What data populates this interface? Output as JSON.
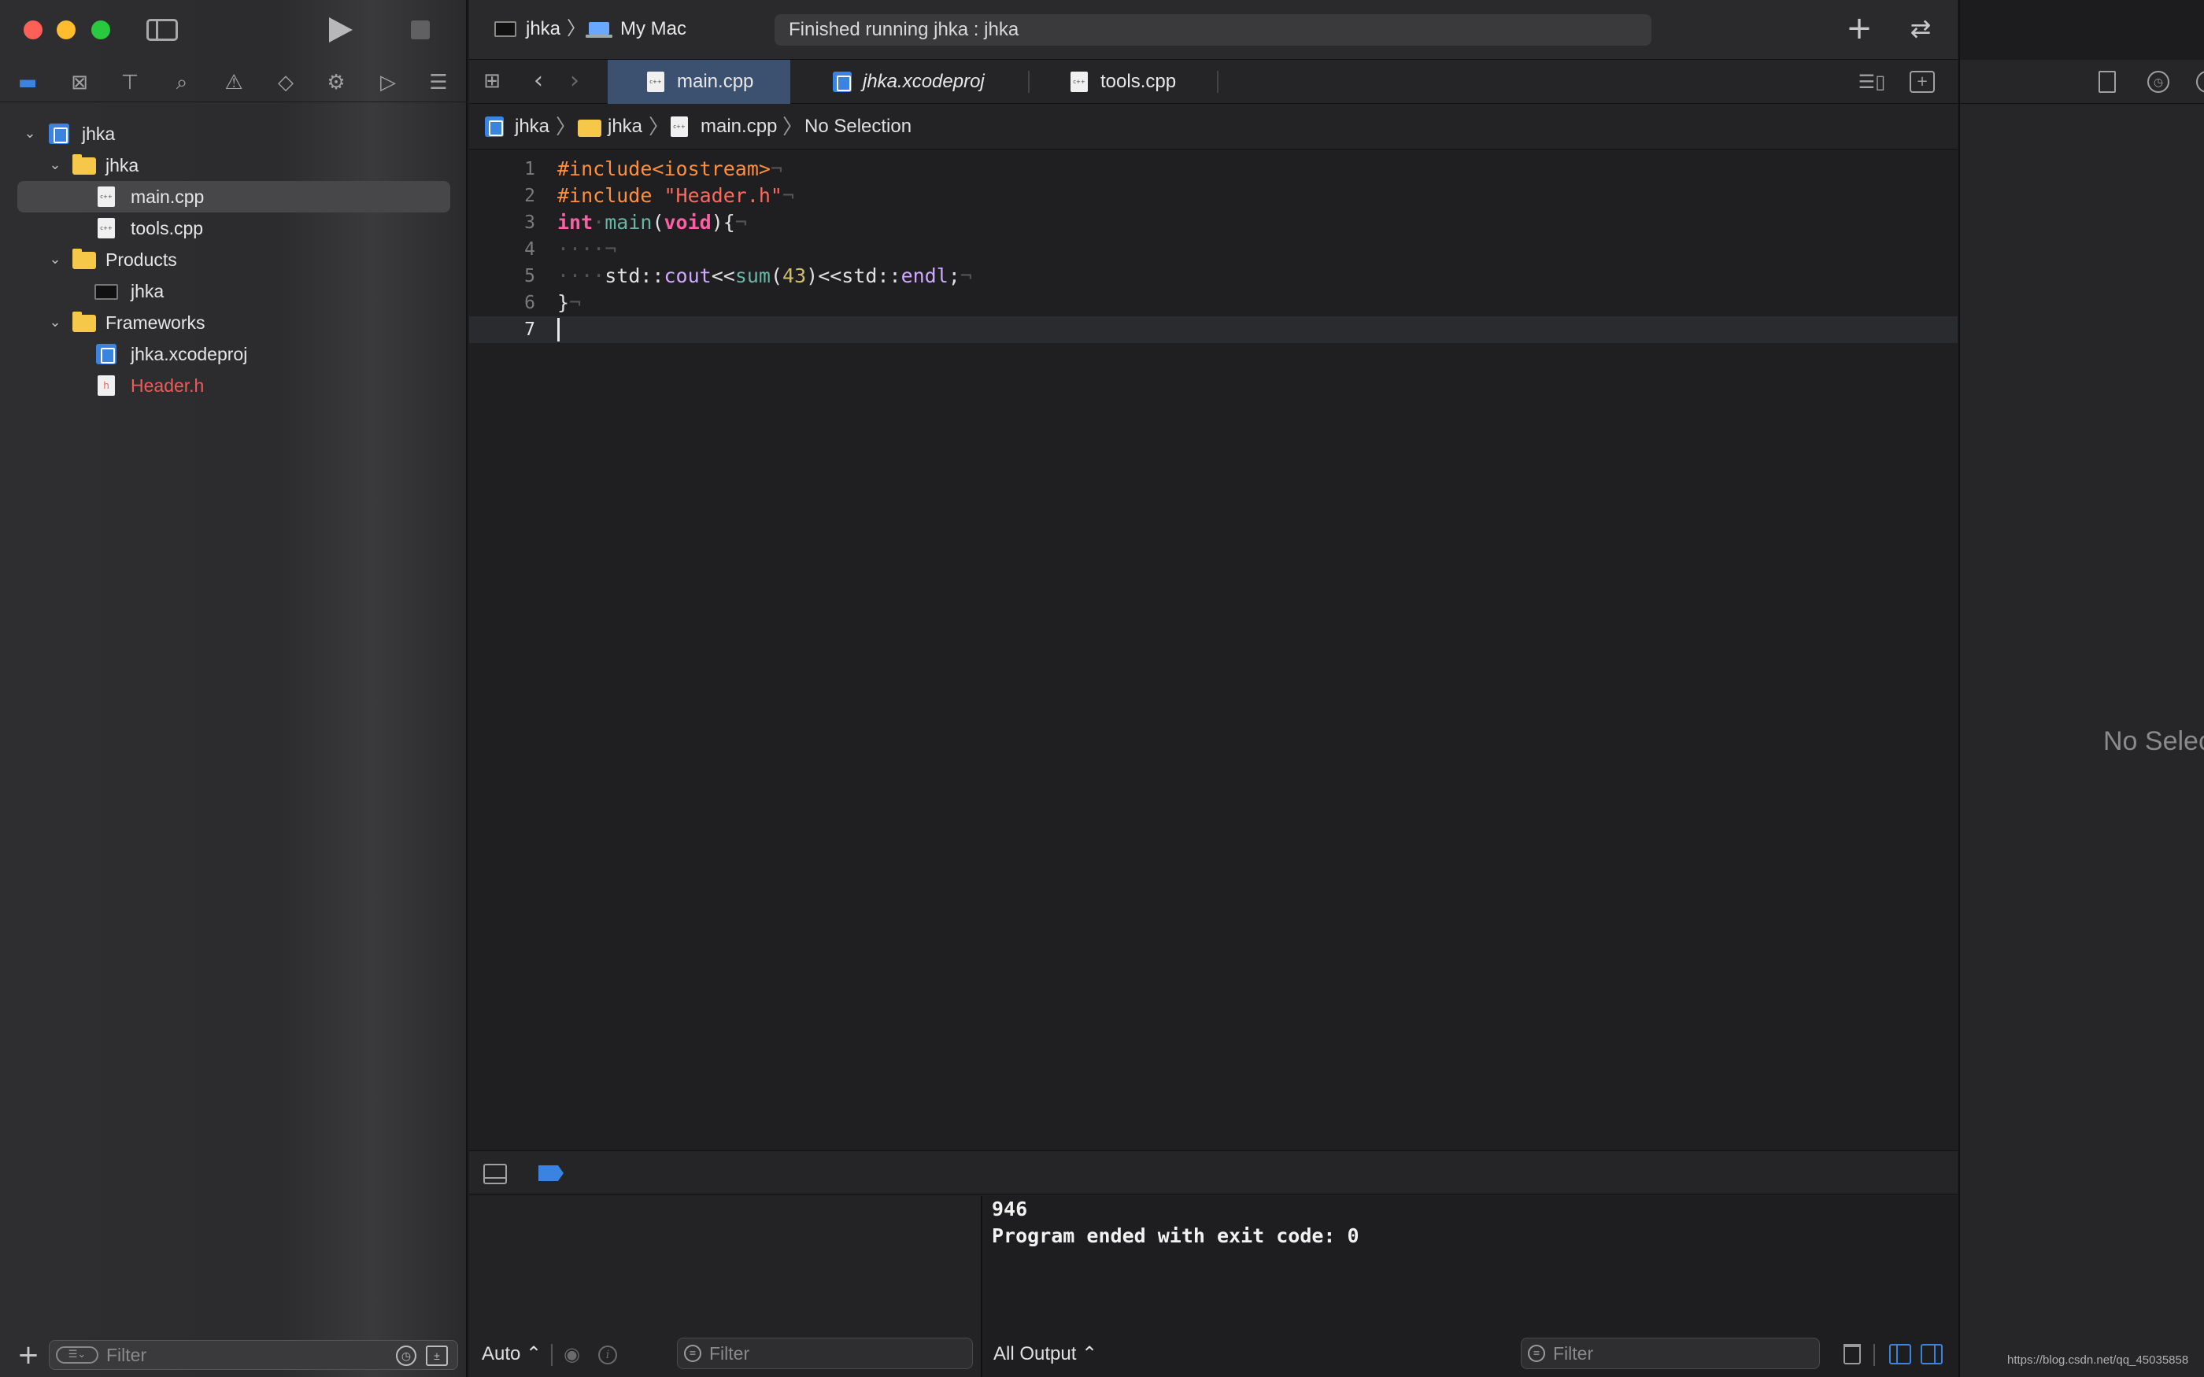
{
  "window": {
    "run_icon": "play-icon",
    "stop_icon": "stop-icon"
  },
  "toolbar": {
    "scheme": "jhka",
    "destination": "My Mac",
    "activity": "Finished running jhka : jhka",
    "add_icon": "plus-icon",
    "review_icon": "arrows-left-right-icon"
  },
  "navigator": {
    "icons": [
      "folder-icon",
      "source-control-icon",
      "symbol-icon",
      "search-icon",
      "issue-icon",
      "test-icon",
      "debug-icon",
      "breakpoint-icon",
      "report-icon"
    ],
    "tree": {
      "project": "jhka",
      "group": "jhka",
      "main_cpp": "main.cpp",
      "tools_cpp": "tools.cpp",
      "products": "Products",
      "product_exec": "jhka",
      "frameworks": "Frameworks",
      "xcodeproj": "jhka.xcodeproj",
      "header": "Header.h"
    },
    "filter_placeholder": "Filter"
  },
  "tabs": {
    "items": [
      {
        "label": "main.cpp",
        "active": true
      },
      {
        "label": "jhka.xcodeproj",
        "active": false
      },
      {
        "label": "tools.cpp",
        "active": false
      }
    ]
  },
  "jumpbar": {
    "project": "jhka",
    "folder": "jhka",
    "file": "main.cpp",
    "symbol": "No Selection"
  },
  "editor": {
    "line_numbers": [
      "1",
      "2",
      "3",
      "4",
      "5",
      "6",
      "7"
    ],
    "current_line": "7",
    "lines": [
      [
        {
          "t": "#include<iostream>",
          "c": "prep"
        },
        {
          "t": "¬",
          "c": "inv"
        }
      ],
      [
        {
          "t": "#include ",
          "c": "prep"
        },
        {
          "t": "\"Header.h\"",
          "c": "str"
        },
        {
          "t": "¬",
          "c": "inv"
        }
      ],
      [
        {
          "t": "int",
          "c": "kw"
        },
        {
          "t": "·",
          "c": "inv"
        },
        {
          "t": "main",
          "c": "fn"
        },
        {
          "t": "(",
          "c": "plain"
        },
        {
          "t": "void",
          "c": "kw"
        },
        {
          "t": "){",
          "c": "plain"
        },
        {
          "t": "¬",
          "c": "inv"
        }
      ],
      [
        {
          "t": "····¬",
          "c": "inv"
        }
      ],
      [
        {
          "t": "····",
          "c": "inv"
        },
        {
          "t": "std::",
          "c": "plain"
        },
        {
          "t": "cout",
          "c": "type"
        },
        {
          "t": "<<",
          "c": "plain"
        },
        {
          "t": "sum",
          "c": "fn"
        },
        {
          "t": "(",
          "c": "plain"
        },
        {
          "t": "43",
          "c": "num"
        },
        {
          "t": ")<<",
          "c": "plain"
        },
        {
          "t": "std::",
          "c": "plain"
        },
        {
          "t": "endl",
          "c": "type"
        },
        {
          "t": ";",
          "c": "plain"
        },
        {
          "t": "¬",
          "c": "inv"
        }
      ],
      [
        {
          "t": "}",
          "c": "plain"
        },
        {
          "t": "¬",
          "c": "inv"
        }
      ],
      []
    ]
  },
  "debug": {
    "variables_scope": "Auto ⌃",
    "variables_filter_placeholder": "Filter",
    "console_output": [
      "946",
      "Program ended with exit code: 0"
    ],
    "output_scope": "All Output ⌃",
    "console_filter_placeholder": "Filter"
  },
  "inspector": {
    "empty_text": "No Selection",
    "watermark": "https://blog.csdn.net/qq_45035858"
  },
  "colors": {
    "accent": "#3b83e0",
    "selected_tab": "#3c5070",
    "folder": "#f5c84a",
    "missing_file": "#ef5a5a",
    "preprocessor": "#fd8f3f",
    "string": "#fc6a5d",
    "keyword": "#fc5fa3"
  }
}
